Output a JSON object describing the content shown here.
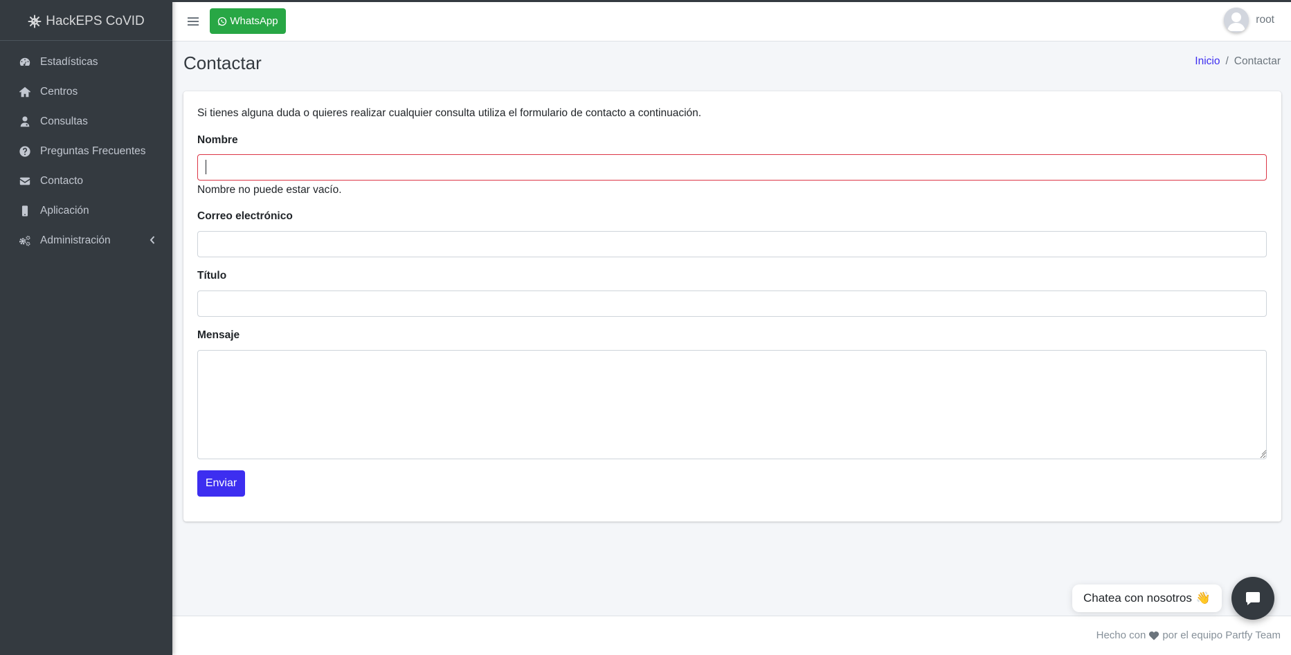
{
  "brand": {
    "name": "HackEPS CoVID",
    "icon": "virus-icon"
  },
  "sidebar": {
    "items": [
      {
        "label": "Estadísticas",
        "icon": "tachometer-icon"
      },
      {
        "label": "Centros",
        "icon": "home-icon"
      },
      {
        "label": "Consultas",
        "icon": "user-md-icon"
      },
      {
        "label": "Preguntas Frecuentes",
        "icon": "question-circle-icon"
      },
      {
        "label": "Contacto",
        "icon": "envelope-icon"
      },
      {
        "label": "Aplicación",
        "icon": "mobile-icon"
      },
      {
        "label": "Administración",
        "icon": "cogs-icon"
      }
    ]
  },
  "header": {
    "whatsapp_label": "WhatsApp",
    "user_name": "root"
  },
  "page": {
    "title": "Contactar",
    "breadcrumb": {
      "home": "Inicio",
      "separator": "/",
      "current": "Contactar"
    }
  },
  "form": {
    "intro": "Si tienes alguna duda o quieres realizar cualquier consulta utiliza el formulario de contacto a continuación.",
    "name_label": "Nombre",
    "name_value": "",
    "name_error": "Nombre no puede estar vacío.",
    "email_label": "Correo electrónico",
    "email_value": "",
    "title_label": "Título",
    "title_value": "",
    "message_label": "Mensaje",
    "message_value": "",
    "submit_label": "Enviar"
  },
  "footer": {
    "text_before": "Hecho con",
    "text_after": "por el equipo Partfy Team"
  },
  "chat": {
    "bubble_text": "Chatea con nosotros",
    "bubble_emoji": "👋"
  },
  "colors": {
    "sidebar_bg": "#343a40",
    "accent": "#3d2ef0",
    "whatsapp": "#28a745",
    "error_border": "#dc3545"
  }
}
